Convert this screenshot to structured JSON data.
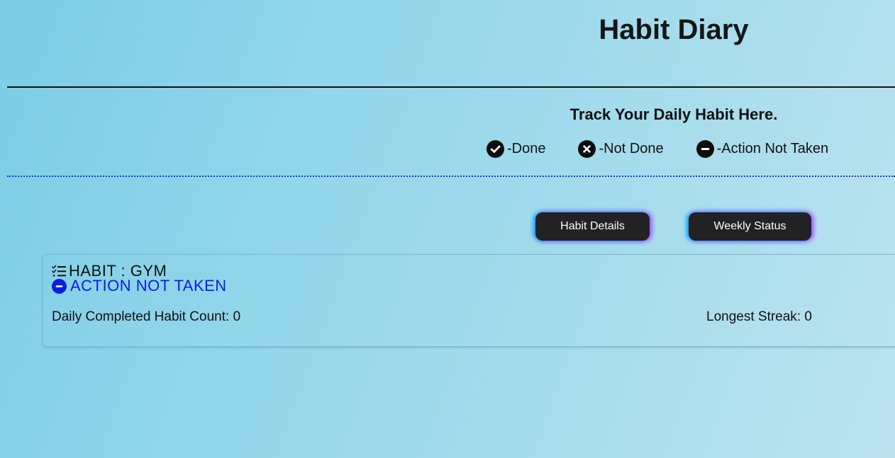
{
  "header": {
    "title": "Habit Diary",
    "subtitle": "Track Your Daily Habit Here."
  },
  "legend": [
    {
      "icon": "check-circle-icon",
      "label": "-Done"
    },
    {
      "icon": "x-circle-icon",
      "label": "-Not Done"
    },
    {
      "icon": "minus-circle-icon",
      "label": "-Action Not Taken"
    }
  ],
  "buttons": {
    "habit_details": "Habit Details",
    "weekly_status": "Weekly Status"
  },
  "habit_card": {
    "name": "HABIT : GYM",
    "icon": "list-check-icon",
    "status": "ACTION NOT TAKEN",
    "status_icon": "minus-circle-icon",
    "status_color": "#0b1ee0",
    "daily_count": "Daily Completed Habit Count: 0",
    "longest_streak": "Longest Streak: 0"
  },
  "colors": {
    "button_bg": "#222222",
    "rule_dotted": "#1533d8"
  }
}
